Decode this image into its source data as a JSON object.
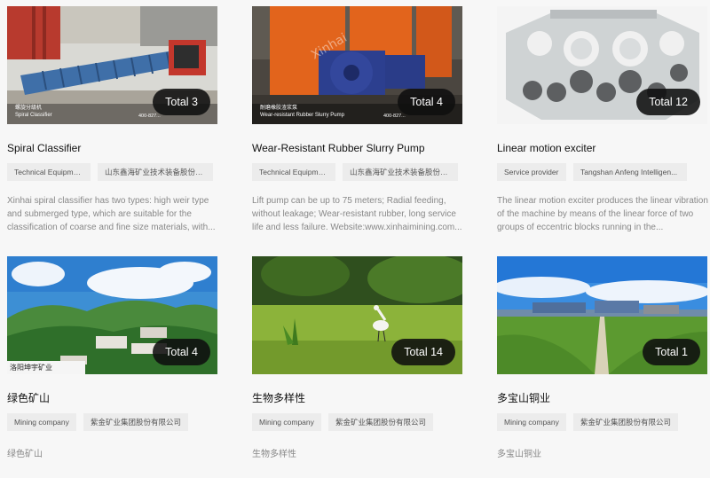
{
  "cards": [
    {
      "total": "Total 3",
      "caption_zh": "螺旋分级机",
      "caption_en": "Spiral Classifier",
      "caption_tel": "400-827...",
      "title": "Spiral Classifier",
      "tags": [
        "Technical Equipment",
        "山东鑫海矿业技术装备股份有..."
      ],
      "desc": "Xinhai spiral classifier has two types: high weir type and submerged type, which are suitable for the classification of coarse and fine size materials, with..."
    },
    {
      "total": "Total 4",
      "caption_zh": "耐磨橡胶渣浆泵",
      "caption_en": "Wear-resistant Rubber Slurry Pump",
      "caption_tel": "400-827...",
      "watermark": "Xinhai",
      "title": "Wear-Resistant Rubber Slurry Pump",
      "tags": [
        "Technical Equipment",
        "山东鑫海矿业技术装备股份有..."
      ],
      "desc": "Lift pump can be up to 75 meters; Radial feeding, without leakage; Wear-resistant rubber, long service life and less failure. Website:www.xinhaimining.com..."
    },
    {
      "total": "Total 12",
      "title": "Linear motion exciter",
      "tags": [
        "Service provider",
        "Tangshan Anfeng Intelligen..."
      ],
      "desc": "The linear motion exciter produces the linear vibration of the machine by means of the linear force of two groups of eccentric blocks running in the..."
    },
    {
      "total": "Total 4",
      "caption_zh": "洛阳坤宇矿业",
      "title": "绿色矿山",
      "tags": [
        "Mining company",
        "紫金矿业集团股份有限公司"
      ],
      "desc": "绿色矿山"
    },
    {
      "total": "Total 14",
      "title": "生物多样性",
      "tags": [
        "Mining company",
        "紫金矿业集团股份有限公司"
      ],
      "desc": "生物多样性"
    },
    {
      "total": "Total 1",
      "title": "多宝山铜业",
      "tags": [
        "Mining company",
        "紫金矿业集团股份有限公司"
      ],
      "desc": "多宝山铜业"
    }
  ]
}
